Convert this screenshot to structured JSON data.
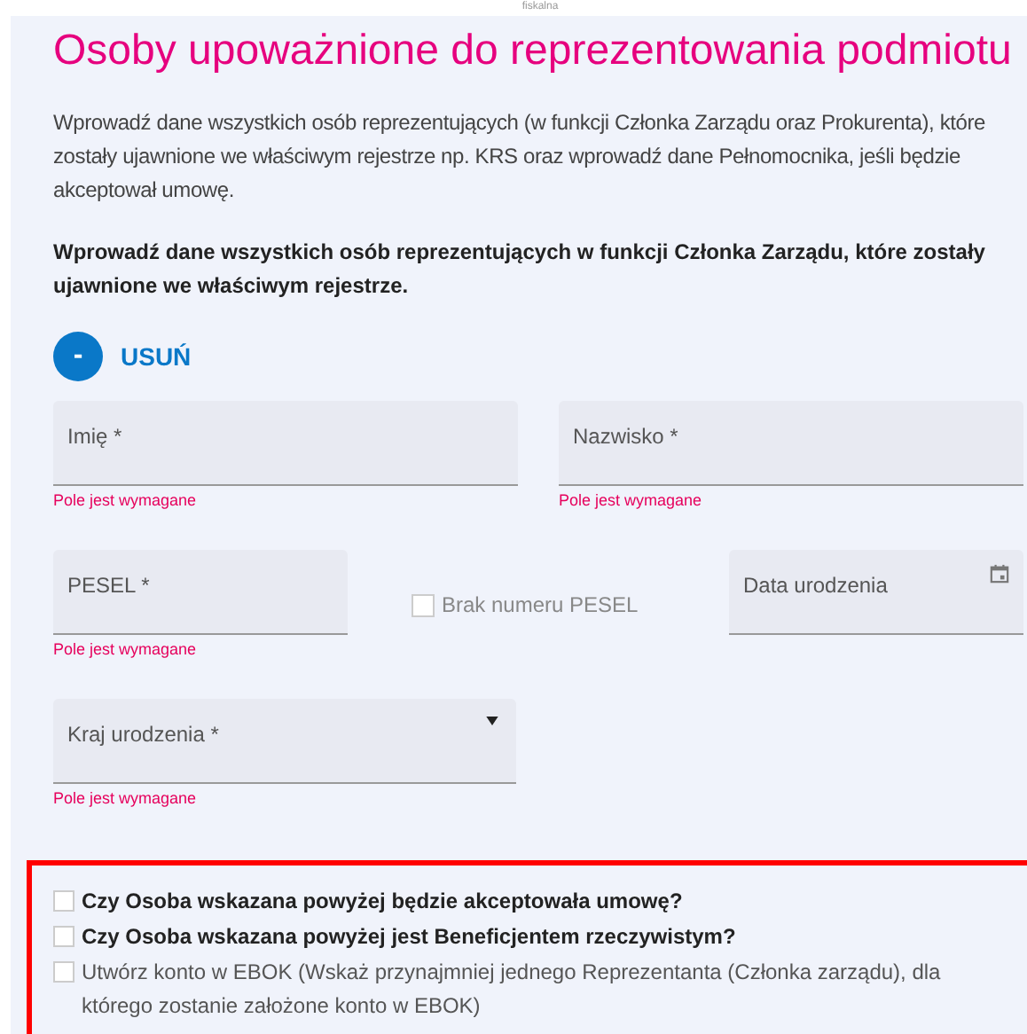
{
  "top_label": "fiskalna",
  "title": "Osoby upoważnione do reprezentowania podmiotu",
  "intro": "Wprowadź dane wszystkich osób reprezentujących (w funkcji Członka Zarządu oraz Prokurenta), które zostały ujawnione we właściwym rejestrze np. KRS oraz wprowadź dane Pełnomocnika, jeśli będzie akceptował umowę.",
  "instruction": "Wprowadź dane wszystkich osób reprezentujących w funkcji Członka Zarządu, które zostały ujawnione we właściwym rejestrze.",
  "remove_button": {
    "icon": "-",
    "label": "USUŃ"
  },
  "name_fields": [
    {
      "label": "Imię *",
      "error": "Pole jest wymagane"
    },
    {
      "label": "Nazwisko *",
      "error": "Pole jest wymagane"
    }
  ],
  "pesel_field": {
    "label": "PESEL *",
    "error": "Pole jest wymagane"
  },
  "no_pesel": {
    "label": "Brak numeru PESEL",
    "checked": false
  },
  "birth_date_field": {
    "label": "Data urodzenia"
  },
  "birth_country_field": {
    "label": "Kraj urodzenia *",
    "error": "Pole jest wymagane"
  },
  "checkboxes": [
    {
      "kind": "question",
      "label": "Czy Osoba wskazana powyżej będzie akceptowała umowę?",
      "checked": false
    },
    {
      "kind": "question",
      "label": "Czy Osoba wskazana powyżej jest Beneficjentem rzeczywistym?",
      "checked": false
    },
    {
      "kind": "option",
      "label": "Utwórz konto w EBOK (Wskaż przynajmniej jednego Reprezentanta (Członka zarządu), dla którego zostanie założone konto w EBOK)",
      "checked": false
    }
  ]
}
